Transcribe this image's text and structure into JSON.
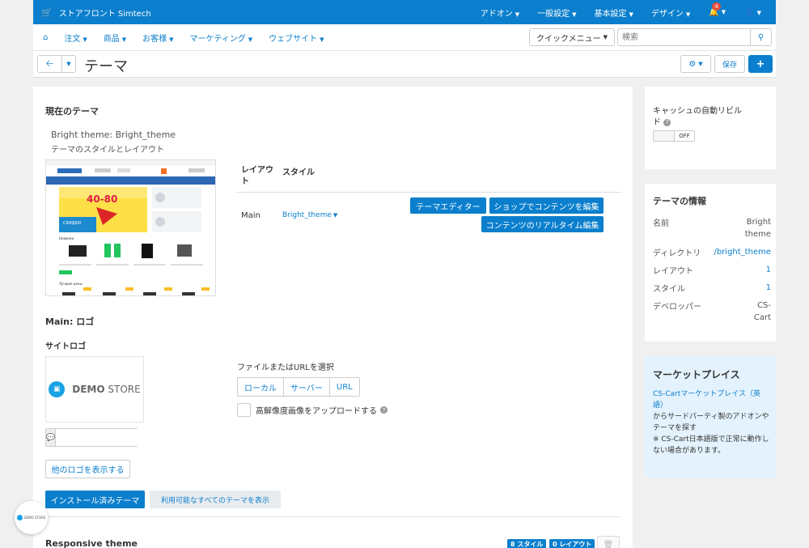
{
  "topbar": {
    "brand": "ストアフロント Simtech",
    "menus": [
      "アドオン",
      "一般設定",
      "基本設定",
      "デザイン"
    ],
    "notification_count": "4"
  },
  "navbar": {
    "items": [
      "注文",
      "商品",
      "お客様",
      "マーケティング",
      "ウェブサイト"
    ],
    "quick_menu": "クイックメニュー",
    "search_placeholder": "検索"
  },
  "titlebar": {
    "title": "テーマ",
    "save_label": "保存"
  },
  "current_theme": {
    "section_title": "現在のテーマ",
    "theme_name": "Bright theme: Bright_theme",
    "theme_subtitle": "テーマのスタイルとレイアウト",
    "table": {
      "col_layout": "レイアウト",
      "col_style": "スタイル",
      "row_layout": "Main",
      "row_style": "Bright_theme"
    },
    "btn_theme_editor": "テーマエディター",
    "btn_edit_content": "ショップでコンテンツを編集",
    "btn_realtime_edit": "コンテンツのリアルタイム編集"
  },
  "preview": {
    "promo": "40-80",
    "sale_text": "СКИДКИ",
    "section_label": "Новинки",
    "section_label2": "Лучшие цены"
  },
  "logo_section": {
    "title": "Main: ロゴ",
    "subtitle": "サイトロゴ",
    "logo_text_bold": "DEMO",
    "logo_text_normal": " STORE",
    "other_logos": "他のロゴを表示する",
    "file_label": "ファイルまたはURLを選択",
    "file_buttons": [
      "ローカル",
      "サーバー",
      "URL"
    ],
    "hires_label": "高解像度画像をアップロードする"
  },
  "tabs": {
    "installed": "インストール済みテーマ",
    "all": "利用可能なすべてのテーマを表示"
  },
  "responsive": {
    "title": "Responsive theme",
    "styles_badge": "8 スタイル",
    "layouts_badge": "0 レイアウト"
  },
  "sidebar": {
    "cache_label": "キャッシュの自動リビルド",
    "switch_label": "OFF",
    "info_title": "テーマの情報",
    "info": [
      {
        "label": "名前",
        "value": "Bright theme"
      },
      {
        "label": "ディレクトリ",
        "value": "/bright_theme"
      },
      {
        "label": "レイアウト",
        "value": "1"
      },
      {
        "label": "スタイル",
        "value": "1"
      },
      {
        "label": "デベロッパー",
        "value": "CS-Cart"
      }
    ],
    "market_title": "マーケットプレイス",
    "market_link": "CS-Cartマーケットプレイス（英語）",
    "market_text": "からサードパーティ製のアドオンやテーマを探す",
    "market_note": "※ CS-Cart日本語版で正常に動作しない場合があります。"
  },
  "float_badge": "DEMO STORE",
  "colors": {
    "primary": "#0b7fcd",
    "badge_red": "#e74c3c",
    "market_bg": "#e3f2fc"
  }
}
